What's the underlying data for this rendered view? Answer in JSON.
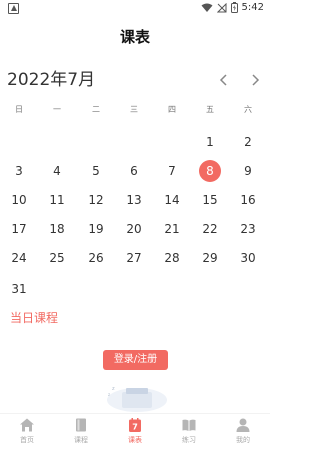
{
  "status_bar": {
    "time": "5:42"
  },
  "header": {
    "title": "课表"
  },
  "calendar": {
    "month_label": "2022年7月",
    "weekdays": [
      "日",
      "一",
      "二",
      "三",
      "四",
      "五",
      "六"
    ],
    "selected_day": "8",
    "weeks": [
      [
        "",
        "",
        "",
        "",
        "",
        "1",
        "2"
      ],
      [
        "3",
        "4",
        "5",
        "6",
        "7",
        "8",
        "9"
      ],
      [
        "10",
        "11",
        "12",
        "13",
        "14",
        "15",
        "16"
      ],
      [
        "17",
        "18",
        "19",
        "20",
        "21",
        "22",
        "23"
      ],
      [
        "24",
        "25",
        "26",
        "27",
        "28",
        "29",
        "30"
      ],
      [
        "31",
        "",
        "",
        "",
        "",
        "",
        ""
      ]
    ]
  },
  "today_courses": {
    "title": "当日课程"
  },
  "login_button": {
    "label": "登录/注册"
  },
  "tabs": [
    {
      "label": "首页",
      "icon": "home-icon",
      "active": false
    },
    {
      "label": "课程",
      "icon": "book-icon",
      "active": false
    },
    {
      "label": "课表",
      "icon": "calendar-icon",
      "active": true,
      "badge": "7"
    },
    {
      "label": "练习",
      "icon": "open-book-icon",
      "active": false
    },
    {
      "label": "我的",
      "icon": "person-icon",
      "active": false
    }
  ],
  "colors": {
    "accent": "#f26a62",
    "inactive": "#aaaaaa"
  }
}
